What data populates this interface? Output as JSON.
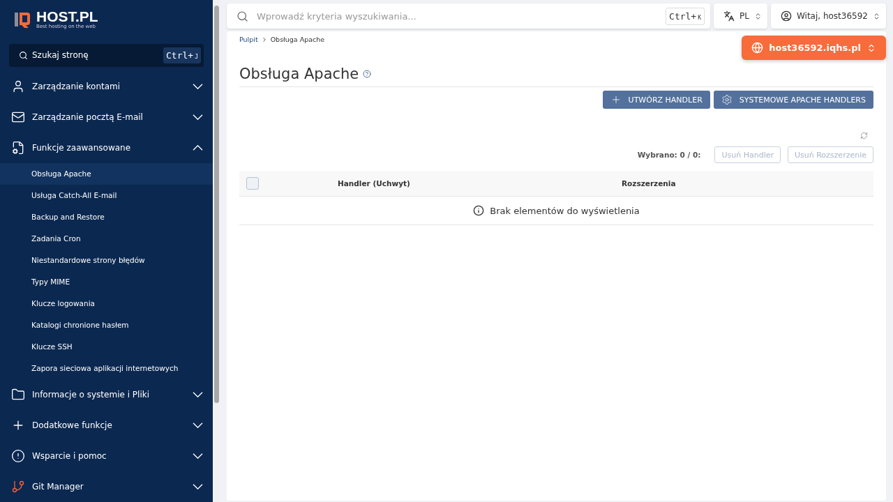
{
  "logo": {
    "name": "HOST.PL",
    "tagline": "Best hosting on the web"
  },
  "sidebar": {
    "search": {
      "placeholder": "Szukaj stronę",
      "shortcut": "Ctrl+",
      "shortcut_key": "J"
    },
    "sections": [
      {
        "label": "Zarządzanie kontami",
        "expanded": false
      },
      {
        "label": "Zarządzanie pocztą E-mail",
        "expanded": false
      },
      {
        "label": "Funkcje zaawansowane",
        "expanded": true,
        "children": [
          {
            "label": "Obsługa Apache",
            "selected": true
          },
          {
            "label": "Usługa Catch-All E-mail",
            "selected": false
          },
          {
            "label": "Backup and Restore",
            "selected": false
          },
          {
            "label": "Zadania Cron",
            "selected": false
          },
          {
            "label": "Niestandardowe strony błędów",
            "selected": false
          },
          {
            "label": "Typy MIME",
            "selected": false
          },
          {
            "label": "Klucze logowania",
            "selected": false
          },
          {
            "label": "Katalogi chronione hasłem",
            "selected": false
          },
          {
            "label": "Klucze SSH",
            "selected": false
          },
          {
            "label": "Zapora sieciowa aplikacji internetowych",
            "selected": false
          }
        ]
      },
      {
        "label": "Informacje o systemie i Pliki",
        "expanded": false
      },
      {
        "label": "Dodatkowe funkcje",
        "expanded": false
      },
      {
        "label": "Wsparcie i pomoc",
        "expanded": false
      },
      {
        "label": "Git Manager",
        "expanded": false
      }
    ]
  },
  "topbar": {
    "search": {
      "placeholder": "Wprowadź kryteria wyszukiwania...",
      "shortcut": "Ctrl+",
      "shortcut_key": "K"
    },
    "language": "PL",
    "user": "Witaj, host36592"
  },
  "breadcrumb": [
    "Pulpit",
    "Obsługa Apache"
  ],
  "domain": "host36592.iqhs.pl",
  "title": "Obsługa Apache",
  "actions": [
    {
      "label": "UTWÓRZ HANDLER"
    },
    {
      "label": "SYSTEMOWE APACHE HANDLERS"
    }
  ],
  "selection": {
    "label": "Wybrano: 0 / 0:",
    "buttons": [
      {
        "label": "Usuń Handler",
        "disabled": true
      },
      {
        "label": "Usuń Rozszerzenie",
        "disabled": true
      }
    ]
  },
  "table": {
    "select_all": false,
    "columns": [
      "Handler (Uchwyt)",
      "Rozszerzenia"
    ],
    "empty": "Brak elementów do wyświetlenia"
  }
}
